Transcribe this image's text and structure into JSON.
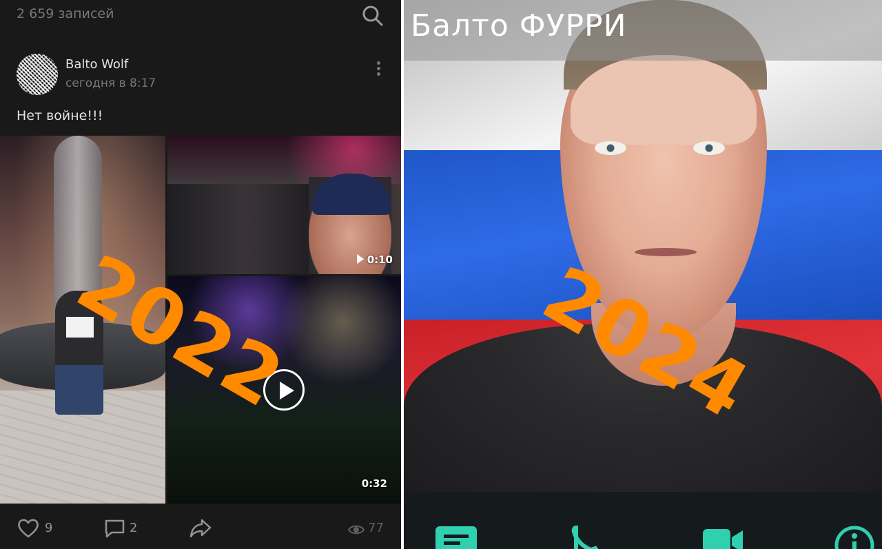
{
  "feed": {
    "post_count": "2 659 записей",
    "search_icon": "search-icon"
  },
  "post": {
    "author_name": "Balto Wolf",
    "time": "сегодня в 8:17",
    "text": "Нет войне!!!",
    "media": {
      "video_1_duration": "0:10",
      "video_2_duration": "0:32"
    },
    "actions": {
      "likes": "9",
      "comments": "2",
      "views": "77"
    }
  },
  "profile": {
    "name": "Балто ФУРРИ"
  },
  "overlays": {
    "left_year": "2022",
    "right_year": "2024",
    "color": "#ff8a00"
  },
  "colors": {
    "dark_bg": "#19191a",
    "muted_text": "#76787a",
    "accent_teal": "#2fd0b0"
  }
}
